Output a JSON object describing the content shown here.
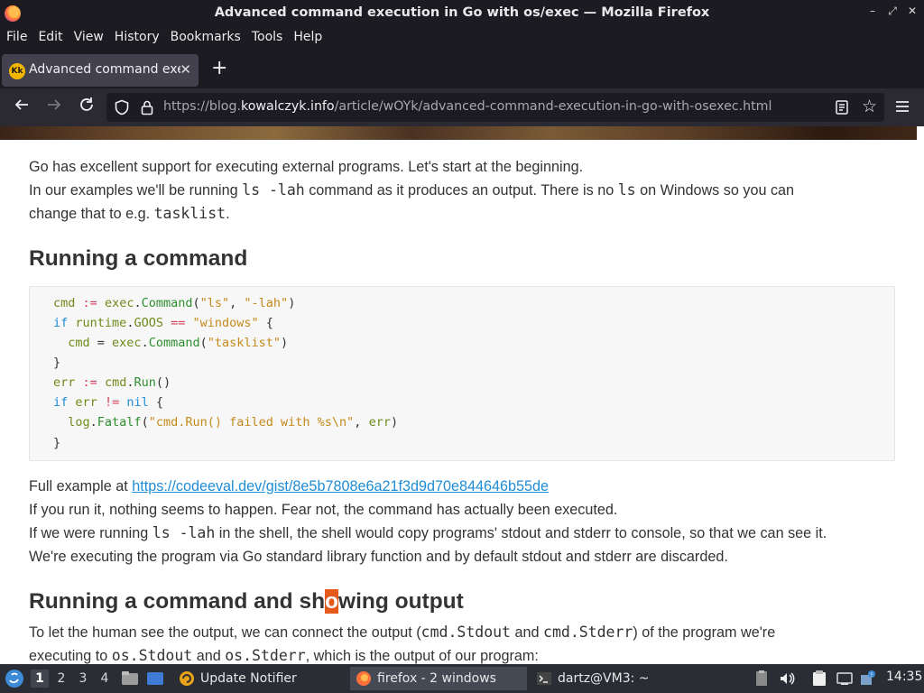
{
  "window": {
    "title": "Advanced command execution in Go with os/exec — Mozilla Firefox",
    "buttons": {
      "minimize": "–",
      "restore": "⤢",
      "close": "✕"
    }
  },
  "menubar": [
    "File",
    "Edit",
    "View",
    "History",
    "Bookmarks",
    "Tools",
    "Help"
  ],
  "tab": {
    "title": "Advanced command execution in Go with os/exec",
    "favicon_text": "Kk",
    "close": "✕"
  },
  "newtab_label": "+",
  "urlbar": {
    "prefix": "https://blog.",
    "domain": "kowalczyk.info",
    "path": "/article/wOYk/advanced-command-execution-in-go-with-osexec.html"
  },
  "article": {
    "p1": "Go has excellent support for executing external programs. Let's start at the beginning.",
    "p2": {
      "a": "In our examples we'll be running ",
      "code1": "ls -lah",
      "b": " command as it produces an output. There is no ",
      "code2": "ls",
      "c": " on Windows so you can"
    },
    "p3": {
      "a": "change that to e.g. ",
      "code": "tasklist",
      "b": "."
    },
    "heading1": "Running a command",
    "code_lines": [
      [
        [
          "var",
          "cmd"
        ],
        [
          "pl",
          " "
        ],
        [
          "op",
          ":="
        ],
        [
          "pl",
          " "
        ],
        [
          "var",
          "exec"
        ],
        [
          "pl",
          "."
        ],
        [
          "fn",
          "Command"
        ],
        [
          "pl",
          "("
        ],
        [
          "str",
          "\"ls\""
        ],
        [
          "pl",
          ", "
        ],
        [
          "str",
          "\"-lah\""
        ],
        [
          "pl",
          ")"
        ]
      ],
      [
        [
          "kw",
          "if"
        ],
        [
          "pl",
          " "
        ],
        [
          "var",
          "runtime"
        ],
        [
          "pl",
          "."
        ],
        [
          "var",
          "GOOS"
        ],
        [
          "pl",
          " "
        ],
        [
          "op",
          "=="
        ],
        [
          "pl",
          " "
        ],
        [
          "str",
          "\"windows\""
        ],
        [
          "pl",
          " {"
        ]
      ],
      [
        [
          "pl",
          "  "
        ],
        [
          "var",
          "cmd"
        ],
        [
          "pl",
          " = "
        ],
        [
          "var",
          "exec"
        ],
        [
          "pl",
          "."
        ],
        [
          "fn",
          "Command"
        ],
        [
          "pl",
          "("
        ],
        [
          "str",
          "\"tasklist\""
        ],
        [
          "pl",
          ")"
        ]
      ],
      [
        [
          "pl",
          "}"
        ]
      ],
      [
        [
          "var",
          "err"
        ],
        [
          "pl",
          " "
        ],
        [
          "op",
          ":="
        ],
        [
          "pl",
          " "
        ],
        [
          "var",
          "cmd"
        ],
        [
          "pl",
          "."
        ],
        [
          "fn",
          "Run"
        ],
        [
          "pl",
          "()"
        ]
      ],
      [
        [
          "kw",
          "if"
        ],
        [
          "pl",
          " "
        ],
        [
          "var",
          "err"
        ],
        [
          "pl",
          " "
        ],
        [
          "op",
          "!="
        ],
        [
          "pl",
          " "
        ],
        [
          "kw",
          "nil"
        ],
        [
          "pl",
          " {"
        ]
      ],
      [
        [
          "pl",
          "  "
        ],
        [
          "var",
          "log"
        ],
        [
          "pl",
          "."
        ],
        [
          "fn",
          "Fatalf"
        ],
        [
          "pl",
          "("
        ],
        [
          "str",
          "\"cmd.Run() failed with %s\\n\""
        ],
        [
          "pl",
          ", "
        ],
        [
          "var",
          "err"
        ],
        [
          "pl",
          ")"
        ]
      ],
      [
        [
          "pl",
          "}"
        ]
      ]
    ],
    "full_example_label": "Full example at ",
    "full_example_link": "https://codeeval.dev/gist/8e5b7808e6a21f3d9d70e844646b55de",
    "p4": "If you run it, nothing seems to happen. Fear not, the command has actually been executed.",
    "p5": {
      "a": "If we were running ",
      "code": "ls -lah",
      "b": " in the shell, the shell would copy programs' stdout and stderr to console, so that we can see it."
    },
    "p6": "We're executing the program via Go standard library function and by default stdout and stderr are discarded.",
    "heading2": {
      "a": "Running a command and sh",
      "hl": "o",
      "b": "wing output"
    },
    "p7": {
      "a": "To let the human see the output, we can connect the output (",
      "code1": "cmd.Stdout",
      "b": " and ",
      "code2": "cmd.Stderr",
      "c": ") of the program we're"
    },
    "p8": {
      "a": "executing to ",
      "code1": "os.Stdout",
      "b": " and ",
      "code2": "os.Stderr",
      "c": ", which is the output of our program:"
    }
  },
  "taskbar": {
    "workspaces": [
      "1",
      "2",
      "3",
      "4"
    ],
    "tasks": [
      {
        "label": "Update Notifier"
      },
      {
        "label": "firefox - 2 windows"
      },
      {
        "label": "dartz@VM3: ~"
      }
    ],
    "clock": "14:35"
  },
  "colors": {
    "link": "#1f8dd6",
    "keyword": "#1f8dd6",
    "string": "#c48a1a",
    "operator": "#d43f5a",
    "highlight": "#e55a1a"
  }
}
